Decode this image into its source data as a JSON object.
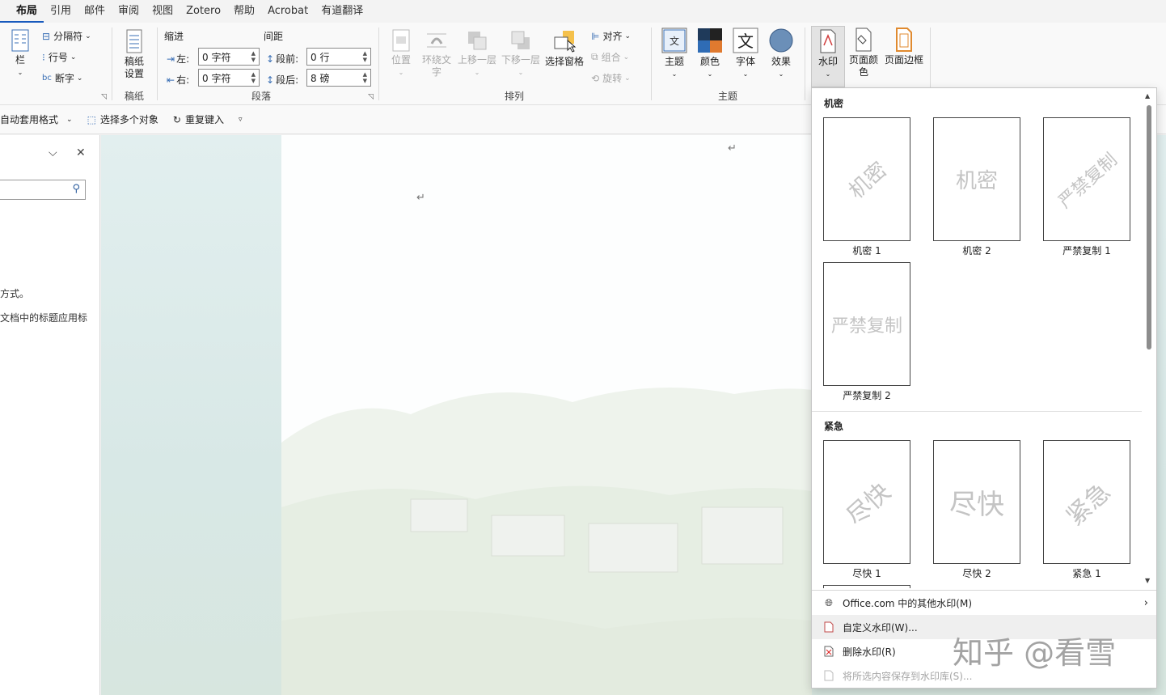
{
  "tabs": [
    "布局",
    "引用",
    "邮件",
    "审阅",
    "视图",
    "Zotero",
    "帮助",
    "Acrobat",
    "有道翻译"
  ],
  "active_tab": "布局",
  "ribbon": {
    "columns_label": "栏",
    "breaks_label": "分隔符",
    "line_numbers_label": "行号",
    "hyphenation_label": "断字",
    "manuscript_button": "稿纸\n设置",
    "manuscript_group": "稿纸",
    "indent_header": "缩进",
    "spacing_header": "间距",
    "indent_left_label": "左:",
    "indent_left_value": "0 字符",
    "indent_right_label": "右:",
    "indent_right_value": "0 字符",
    "space_before_label": "段前:",
    "space_before_value": "0 行",
    "space_after_label": "段后:",
    "space_after_value": "8 磅",
    "paragraph_group": "段落",
    "position_label": "位置",
    "wrap_text_label": "环绕文\n字",
    "bring_forward_label": "上移一层",
    "send_backward_label": "下移一层",
    "selection_pane_label": "选择窗格",
    "align_label": "对齐",
    "group_label": "组合",
    "rotate_label": "旋转",
    "arrange_group": "排列",
    "themes_label": "主题",
    "colors_label": "颜色",
    "fonts_label": "字体",
    "effects_label": "效果",
    "themes_group": "主题",
    "watermark_label": "水印",
    "page_color_label": "页面颜\n色",
    "page_borders_label": "页面边框"
  },
  "quickbar": {
    "autoformat_label": "自动套用格式",
    "select_objects_label": "选择多个对象",
    "repeat_typing_label": "重复键入"
  },
  "navpane": {
    "text1": "方式。",
    "text2": "文档中的标题应用标"
  },
  "dropdown": {
    "section1_title": "机密",
    "section2_title": "紧急",
    "watermarks_section1": [
      {
        "label": "机密 1",
        "text": "机密",
        "style": "diagonal"
      },
      {
        "label": "机密 2",
        "text": "机密",
        "style": "horizontal"
      },
      {
        "label": "严禁复制 1",
        "text": "严禁复制",
        "style": "diagonal"
      },
      {
        "label": "严禁复制 2",
        "text": "严禁复制",
        "style": "horizontal"
      }
    ],
    "watermarks_section2": [
      {
        "label": "尽快 1",
        "text": "尽快",
        "style": "diagonal"
      },
      {
        "label": "尽快 2",
        "text": "尽快",
        "style": "horizontal"
      },
      {
        "label": "紧急 1",
        "text": "紧急",
        "style": "diagonal"
      }
    ],
    "menu": {
      "more_office": "Office.com 中的其他水印(M)",
      "custom": "自定义水印(W)...",
      "remove": "删除水印(R)",
      "save_selection": "将所选内容保存到水印库(S)..."
    }
  },
  "overlay_watermark": "知乎 @看雪",
  "paragraph_mark": "↵",
  "colors": {
    "accent": "#185abd",
    "doc_background": "#dcebea"
  }
}
